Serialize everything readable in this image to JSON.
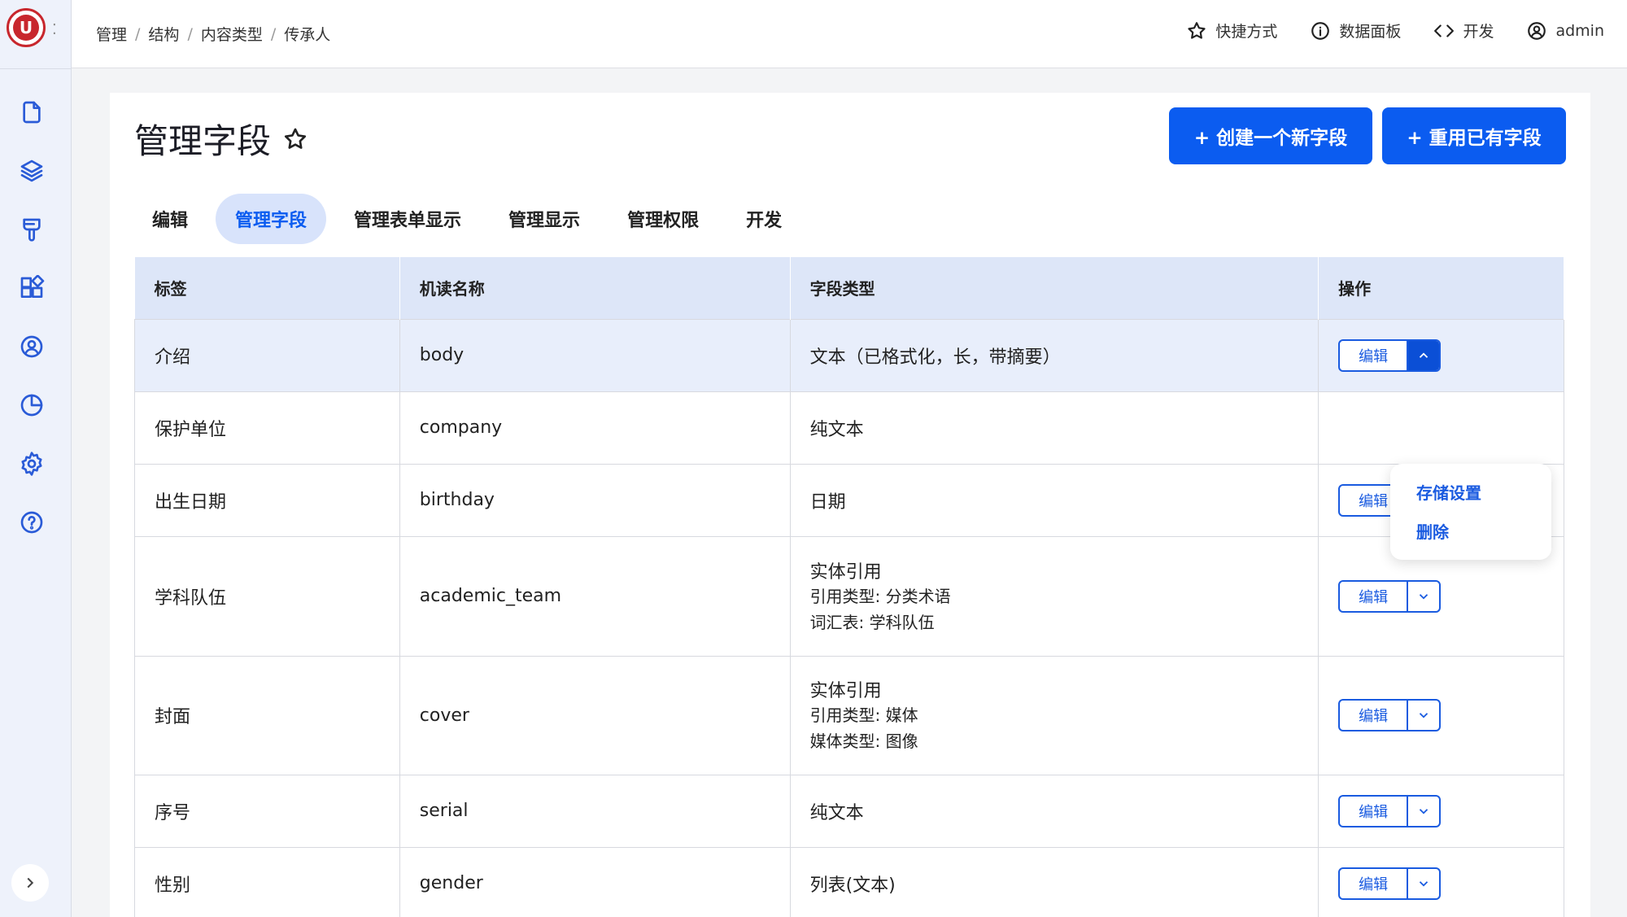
{
  "topbar": {
    "breadcrumbs": [
      "管理",
      "结构",
      "内容类型",
      "传承人"
    ],
    "actions": {
      "shortcuts": "快捷方式",
      "dashboard": "数据面板",
      "develop": "开发",
      "user": "admin"
    }
  },
  "sidebar": {
    "icons": [
      "file-icon",
      "layers-icon",
      "brush-icon",
      "blocks-icon",
      "user-icon",
      "pie-chart-icon",
      "gear-icon",
      "help-icon"
    ]
  },
  "page": {
    "title": "管理字段",
    "buttons": {
      "create_new": "+ 创建一个新字段",
      "reuse": "+ 重用已有字段"
    },
    "tabs": [
      "编辑",
      "管理字段",
      "管理表单显示",
      "管理显示",
      "管理权限",
      "开发"
    ],
    "active_tab": "管理字段"
  },
  "table": {
    "headers": [
      "标签",
      "机读名称",
      "字段类型",
      "操作"
    ],
    "edit_label": "编辑",
    "rows": [
      {
        "label": "介绍",
        "machine": "body",
        "type": "文本（已格式化，长，带摘要）",
        "sub": []
      },
      {
        "label": "保护单位",
        "machine": "company",
        "type": "纯文本",
        "sub": []
      },
      {
        "label": "出生日期",
        "machine": "birthday",
        "type": "日期",
        "sub": []
      },
      {
        "label": "学科队伍",
        "machine": "academic_team",
        "type": "实体引用",
        "sub": [
          "引用类型: 分类术语",
          "词汇表: 学科队伍"
        ]
      },
      {
        "label": "封面",
        "machine": "cover",
        "type": "实体引用",
        "sub": [
          "引用类型: 媒体",
          "媒体类型: 图像"
        ]
      },
      {
        "label": "序号",
        "machine": "serial",
        "type": "纯文本",
        "sub": []
      },
      {
        "label": "性别",
        "machine": "gender",
        "type": "列表(文本)",
        "sub": []
      }
    ]
  },
  "dropdown": {
    "items": [
      "存储设置",
      "删除"
    ]
  },
  "colors": {
    "primary": "#0b5cf0",
    "header_bg": "#dde6f8",
    "highlight_row": "#e8eefb"
  }
}
